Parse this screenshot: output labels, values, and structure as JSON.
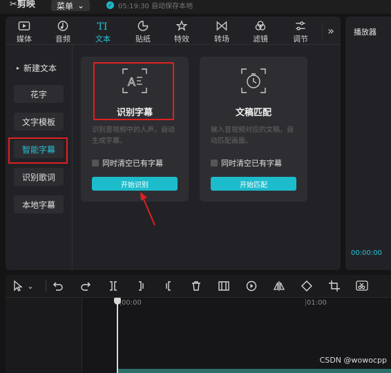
{
  "app": {
    "title": "剪映",
    "menu_label": "菜单",
    "save_status": "05:19:30 自动保存本地"
  },
  "tabs": [
    {
      "label": "媒体",
      "icon": "media-icon"
    },
    {
      "label": "音频",
      "icon": "audio-icon"
    },
    {
      "label": "文本",
      "icon": "text-icon",
      "active": true
    },
    {
      "label": "贴纸",
      "icon": "sticker-icon"
    },
    {
      "label": "特效",
      "icon": "effects-icon"
    },
    {
      "label": "转场",
      "icon": "transition-icon"
    },
    {
      "label": "滤镜",
      "icon": "filter-icon"
    },
    {
      "label": "调节",
      "icon": "adjust-icon"
    }
  ],
  "more_label": "»",
  "sidebar": {
    "items": [
      {
        "label": "新建文本"
      },
      {
        "label": "花字"
      },
      {
        "label": "文字模板"
      },
      {
        "label": "智能字幕",
        "active": true
      },
      {
        "label": "识别歌词"
      },
      {
        "label": "本地字幕"
      }
    ]
  },
  "cards": [
    {
      "title": "识别字幕",
      "desc": "识别音视频中的人声，自动生成字幕。",
      "checkbox_label": "同时清空已有字幕",
      "button_label": "开始识别"
    },
    {
      "title": "文稿匹配",
      "desc": "输入音视频对应的文稿，自动匹配画面。",
      "checkbox_label": "同时清空已有字幕",
      "button_label": "开始匹配"
    }
  ],
  "player": {
    "title": "播放器",
    "time": "00:00:00"
  },
  "timeline": {
    "ticks": [
      "00:00",
      "01:00"
    ]
  },
  "watermark": "CSDN @wowocpp",
  "colors": {
    "accent": "#22c3d6",
    "annotation": "#e02020"
  }
}
